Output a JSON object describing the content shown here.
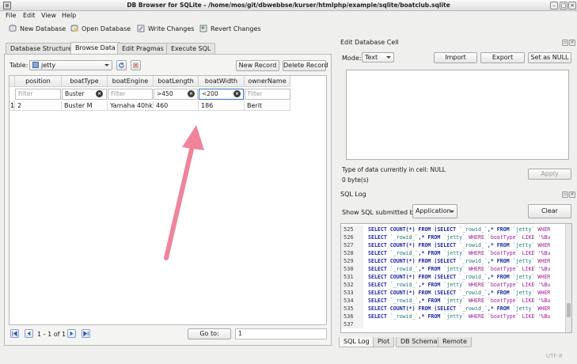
{
  "window": {
    "title": "DB Browser for SQLite - /home/mos/git/dbwebbse/kurser/htmlphp/example/sqlite/boatclub.sqlite"
  },
  "menu": [
    "File",
    "Edit",
    "View",
    "Help"
  ],
  "toolbar": {
    "new_db": "New Database",
    "open_db": "Open Database",
    "write": "Write Changes",
    "revert": "Revert Changes"
  },
  "tabs": [
    "Database Structure",
    "Browse Data",
    "Edit Pragmas",
    "Execute SQL"
  ],
  "browse": {
    "table_label": "Table:",
    "table_value": "jetty",
    "new_record": "New Record",
    "delete_record": "Delete Record",
    "columns": [
      "position",
      "boatType",
      "boatEngine",
      "boatLength",
      "boatWidth",
      "ownerName"
    ],
    "filters": [
      "Filter",
      "Buster",
      "Filter",
      ">450",
      "<200",
      "Filter"
    ],
    "row": {
      "num": "1",
      "cells": [
        "2",
        "Buster M",
        "Yamaha 40hk",
        "460",
        "186",
        "Berit"
      ]
    },
    "pager": "1 - 1 of 1",
    "goto_label": "Go to:",
    "goto_value": "1"
  },
  "edit_cell": {
    "title": "Edit Database Cell",
    "mode_label": "Mode:",
    "mode_value": "Text",
    "import": "Import",
    "export": "Export",
    "set_null": "Set as NULL",
    "type_info": "Type of data currently in cell: NULL",
    "size_info": "0 byte(s)",
    "apply": "Apply"
  },
  "sql_log": {
    "title": "SQL Log",
    "show_label": "Show SQL submitted by",
    "show_value": "Application",
    "clear": "Clear",
    "lines": [
      {
        "n": "525",
        "a": "SELECT COUNT(*) FROM (SELECT ",
        "b": "`_rowid_`",
        "c": ",* FROM ",
        "d": "`jetty`",
        "e": " WHER"
      },
      {
        "n": "526",
        "a": "SELECT ",
        "b": "`_rowid_`",
        "c": ",* FROM ",
        "d": "`jetty`",
        "e": " WHERE `boatType` LIKE '%Bu"
      },
      {
        "n": "527",
        "a": "SELECT COUNT(*) FROM (SELECT ",
        "b": "`_rowid_`",
        "c": ",* FROM ",
        "d": "`jetty`",
        "e": " WHER"
      },
      {
        "n": "528",
        "a": "SELECT ",
        "b": "`_rowid_`",
        "c": ",* FROM ",
        "d": "`jetty`",
        "e": " WHERE `boatType` LIKE '%Bu"
      },
      {
        "n": "529",
        "a": "SELECT COUNT(*) FROM (SELECT ",
        "b": "`_rowid_`",
        "c": ",* FROM ",
        "d": "`jetty`",
        "e": " WHER"
      },
      {
        "n": "530",
        "a": "SELECT ",
        "b": "`_rowid_`",
        "c": ",* FROM ",
        "d": "`jetty`",
        "e": " WHERE `boatType` LIKE '%Bu"
      },
      {
        "n": "531",
        "a": "SELECT COUNT(*) FROM (SELECT ",
        "b": "`_rowid_`",
        "c": ",* FROM ",
        "d": "`jetty`",
        "e": " WHER"
      },
      {
        "n": "532",
        "a": "SELECT ",
        "b": "`_rowid_`",
        "c": ",* FROM ",
        "d": "`jetty`",
        "e": " WHERE `boatType` LIKE '%Bu"
      },
      {
        "n": "533",
        "a": "SELECT COUNT(*) FROM (SELECT ",
        "b": "`_rowid_`",
        "c": ",* FROM ",
        "d": "`jetty`",
        "e": " WHER"
      },
      {
        "n": "534",
        "a": "SELECT ",
        "b": "`_rowid_`",
        "c": ",* FROM ",
        "d": "`jetty`",
        "e": " WHERE `boatType` LIKE '%Bu"
      },
      {
        "n": "535",
        "a": "SELECT COUNT(*) FROM (SELECT ",
        "b": "`_rowid_`",
        "c": ",* FROM ",
        "d": "`jetty`",
        "e": " WHER"
      },
      {
        "n": "536",
        "a": "SELECT ",
        "b": "`_rowid_`",
        "c": ",* FROM ",
        "d": "`jetty`",
        "e": " WHERE `boatType` LIKE '%Bu"
      },
      {
        "n": "537",
        "a": "",
        "b": "",
        "c": "",
        "d": "",
        "e": ""
      }
    ]
  },
  "bottom_tabs": [
    "SQL Log",
    "Plot",
    "DB Schema",
    "Remote"
  ],
  "status": {
    "encoding": "UTF-8"
  },
  "colors": {
    "arrow": "#f0849c",
    "accent": "#3a6fc4"
  }
}
